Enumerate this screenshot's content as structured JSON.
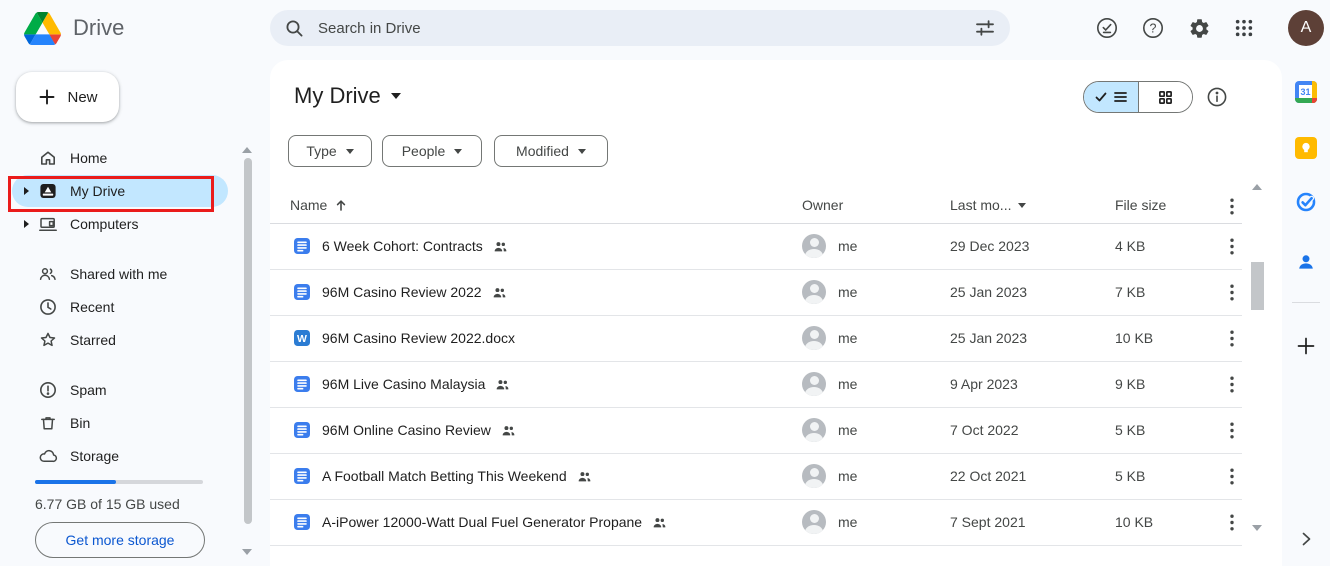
{
  "colors": {
    "background": "#f8fafd",
    "card": "#ffffff",
    "selected_pill": "#c2e7ff",
    "accent_blue": "#0b57d0",
    "progress_blue": "#1a73e8",
    "docs_icon_blue": "#3b7ded",
    "word_icon_blue": "#2b7cd3",
    "keep_yellow": "#ffba00",
    "avatar_brown": "#5d4037",
    "annotation_red": "#ea1b1b"
  },
  "topbar": {
    "logo_text": "Drive",
    "search": {
      "placeholder": "Search in Drive"
    },
    "avatar_letter": "A"
  },
  "sidebar": {
    "new_button_label": "New",
    "items": [
      {
        "label": "Home"
      },
      {
        "label": "My Drive",
        "selected": true,
        "expandable": true
      },
      {
        "label": "Computers",
        "expandable": true
      },
      {
        "label": "Shared with me"
      },
      {
        "label": "Recent"
      },
      {
        "label": "Starred"
      },
      {
        "label": "Spam"
      },
      {
        "label": "Bin"
      },
      {
        "label": "Storage"
      }
    ],
    "storage_used_text": "6.77 GB of 15 GB used",
    "storage_percent": 48,
    "get_more_storage_label": "Get more storage"
  },
  "main": {
    "title": "My Drive",
    "filters": [
      {
        "label": "Type"
      },
      {
        "label": "People"
      },
      {
        "label": "Modified"
      }
    ],
    "table": {
      "headers": {
        "name": "Name",
        "owner": "Owner",
        "modified": "Last mo...",
        "size": "File size"
      },
      "rows": [
        {
          "type": "docs",
          "name": "6 Week Cohort: Contracts",
          "shared": true,
          "owner": "me",
          "modified": "29 Dec 2023",
          "size": "4 KB"
        },
        {
          "type": "docs",
          "name": "96M Casino Review 2022",
          "shared": true,
          "owner": "me",
          "modified": "25 Jan 2023",
          "size": "7 KB"
        },
        {
          "type": "word",
          "name": "96M Casino Review 2022.docx",
          "shared": false,
          "owner": "me",
          "modified": "25 Jan 2023",
          "size": "10 KB"
        },
        {
          "type": "docs",
          "name": "96M Live Casino Malaysia",
          "shared": true,
          "owner": "me",
          "modified": "9 Apr 2023",
          "size": "9 KB"
        },
        {
          "type": "docs",
          "name": "96M Online Casino Review",
          "shared": true,
          "owner": "me",
          "modified": "7 Oct 2022",
          "size": "5 KB"
        },
        {
          "type": "docs",
          "name": "A Football Match Betting This Weekend",
          "shared": true,
          "owner": "me",
          "modified": "22 Oct 2021",
          "size": "5 KB"
        },
        {
          "type": "docs",
          "name": "A-iPower 12000-Watt Dual Fuel Generator Propane",
          "shared": true,
          "owner": "me",
          "modified": "7 Sept 2021",
          "size": "10 KB"
        }
      ]
    }
  }
}
